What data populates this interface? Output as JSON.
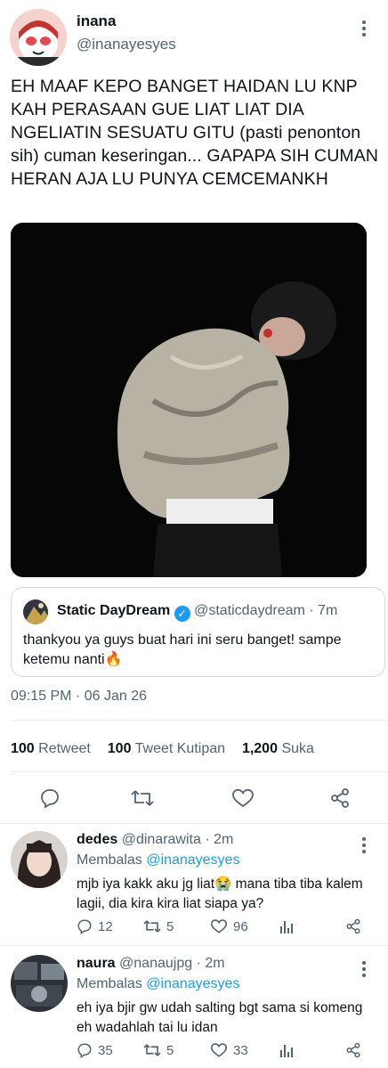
{
  "tweet": {
    "author_name": "inana",
    "author_handle": "@inanayesyes",
    "text": "EH MAAF KEPO BANGET HAIDAN LU KNP KAH PERASAAN GUE LIAT LIAT DIA NGELIATIN SESUATU GITU (pasti penonton sih) cuman keseringan... GAPAPA SIH CUMAN HERAN AJA LU PUNYA CEMCEMANKH",
    "timestamp": "09:15 PM · 06 Jan 26",
    "stats": {
      "retweets_count": "100",
      "retweets_label": "Retweet",
      "quotes_count": "100",
      "quotes_label": "Tweet Kutipan",
      "likes_count": "1,200",
      "likes_label": "Suka"
    }
  },
  "quoted": {
    "author_name": "Static DayDream",
    "author_handle": "@staticdaydream",
    "time": "· 7m",
    "text": "thankyou ya guys buat hari ini seru banget! sampe ketemu nanti🔥"
  },
  "replies": [
    {
      "author_name": "dedes",
      "author_handle": "@dinarawita",
      "time": "· 2m",
      "replying_prefix": "Membalas",
      "replying_to": "@inanayesyes",
      "text": "mjb iya kakk aku jg liat😭 mana tiba tiba kalem lagii, dia kira kira liat siapa ya?",
      "reply_count": "12",
      "retweet_count": "5",
      "like_count": "96"
    },
    {
      "author_name": "naura",
      "author_handle": "@nanaujpg",
      "time": "· 2m",
      "replying_prefix": "Membalas",
      "replying_to": "@inanayesyes",
      "text": "eh iya bjir gw udah salting bgt sama si komeng eh wadahlah tai lu idan",
      "reply_count": "35",
      "retweet_count": "5",
      "like_count": "33"
    }
  ],
  "colors": {
    "accent": "#1d9bf0",
    "muted": "#536471",
    "divider": "#e6ecf0"
  },
  "icons": [
    "more-vertical-icon",
    "verified-badge-icon",
    "reply-icon",
    "retweet-icon",
    "like-icon",
    "share-icon",
    "analytics-icon"
  ]
}
